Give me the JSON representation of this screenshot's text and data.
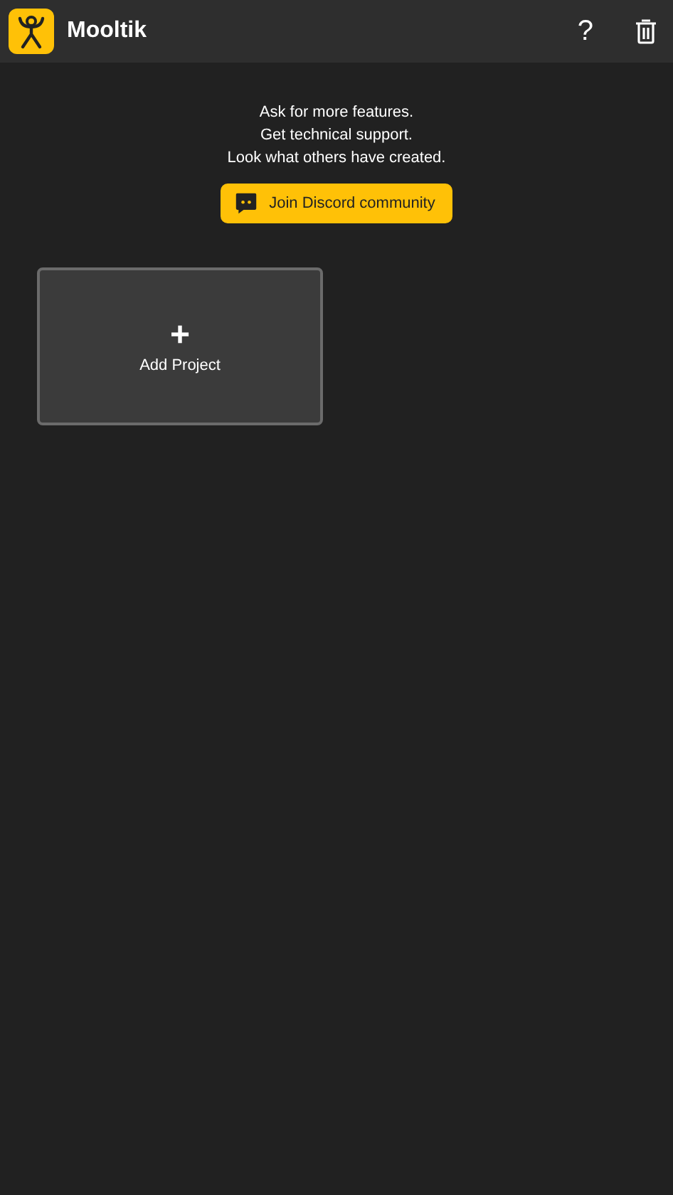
{
  "app_bar": {
    "title": "Mooltik",
    "help_icon_text": "?"
  },
  "info_lines": [
    "Ask for more features.",
    "Get technical support.",
    "Look what others have created."
  ],
  "discord_button": {
    "label": "Join Discord community"
  },
  "projects": [
    {
      "kind": "add",
      "icon_text": "+",
      "label": "Add Project"
    }
  ]
}
